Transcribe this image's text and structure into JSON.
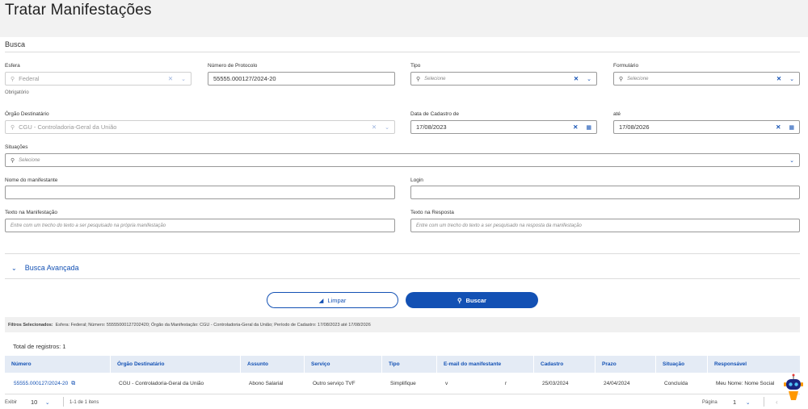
{
  "page": {
    "title": "Tratar Manifestações"
  },
  "busca": {
    "section_title": "Busca",
    "esfera": {
      "label": "Esfera",
      "value": "Federal",
      "note": "Obrigatório"
    },
    "protocolo": {
      "label": "Número de Protocolo",
      "value": "55555.000127/2024-20"
    },
    "tipo": {
      "label": "Tipo",
      "placeholder": "Selecione"
    },
    "formulario": {
      "label": "Formulário",
      "placeholder": "Selecione"
    },
    "orgao": {
      "label": "Órgão Destinatário",
      "value": "CGU - Controladoria-Geral da União"
    },
    "data_de": {
      "label": "Data de Cadastro de",
      "value": "17/08/2023"
    },
    "data_ate": {
      "label": "até",
      "value": "17/08/2026"
    },
    "situacoes": {
      "label": "Situações",
      "placeholder": "Selecione"
    },
    "nome": {
      "label": "Nome do manifestante",
      "value": ""
    },
    "login": {
      "label": "Login",
      "value": ""
    },
    "texto_manifestacao": {
      "label": "Texto na Manifestação",
      "placeholder": "Entre com um trecho do texto a ser pesquisado na própria manifestação"
    },
    "texto_resposta": {
      "label": "Texto na Resposta",
      "placeholder": "Entre com um trecho do texto a ser pesquisado na resposta da manifestação"
    }
  },
  "busca_avancada": {
    "label": "Busca Avançada"
  },
  "buttons": {
    "limpar": "Limpar",
    "buscar": "Buscar"
  },
  "filters": {
    "label": "Filtros Selecionados:",
    "text": "Esfera: Federal; Número: 55555000127202420; Órgão da Manifestação: CGU - Controladoria-Geral da União; Período de Cadastro: 17/08/2023 até 17/08/2026"
  },
  "results": {
    "total": "Total de registros: 1",
    "columns": [
      "Número",
      "Órgão Destinatário",
      "Assunto",
      "Serviço",
      "Tipo",
      "E-mail do manifestante",
      "Cadastro",
      "Prazo",
      "Situação",
      "Responsável"
    ],
    "rows": [
      {
        "numero": "55555.000127/2024-20",
        "orgao": "CGU - Controladoria-Geral da União",
        "assunto": "Abono Salarial",
        "servico": "Outro serviço TVF",
        "tipo": "Simplifique",
        "email_a": "v",
        "email_b": "r",
        "cadastro": "25/03/2024",
        "prazo": "24/04/2024",
        "situacao": "Concluída",
        "responsavel": "Meu Nome: Nome Social"
      }
    ]
  },
  "pagination": {
    "exibir_label": "Exibir",
    "per_page": "10",
    "range": "1-1 de 1 itens",
    "pagina_label": "Página",
    "page": "1"
  },
  "icons": {
    "search": "search-icon",
    "clear": "close-icon",
    "dropdown": "chevron-down-icon",
    "calendar": "calendar-icon",
    "trash": "trash-icon",
    "external": "external-link-icon"
  },
  "colors": {
    "primary": "#1351b4",
    "header_bg": "#f2f2f2",
    "table_header_bg": "#e4ebf5"
  }
}
